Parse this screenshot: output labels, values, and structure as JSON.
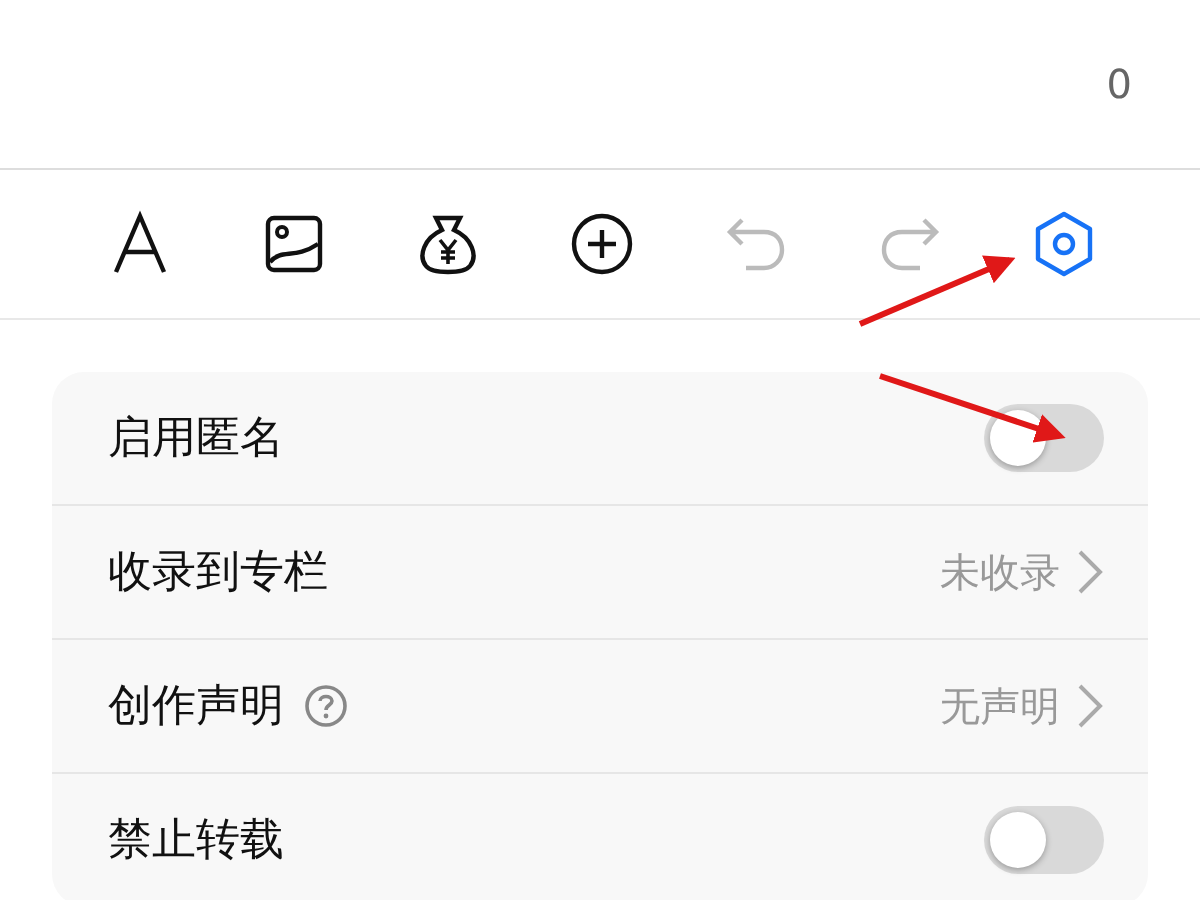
{
  "header": {
    "count": "0"
  },
  "toolbar": [
    {
      "kind": "text",
      "disabled": false,
      "active": false
    },
    {
      "kind": "image",
      "disabled": false,
      "active": false
    },
    {
      "kind": "money",
      "disabled": false,
      "active": false
    },
    {
      "kind": "add",
      "disabled": false,
      "active": false
    },
    {
      "kind": "undo",
      "disabled": true,
      "active": false
    },
    {
      "kind": "redo",
      "disabled": true,
      "active": false
    },
    {
      "kind": "settings",
      "disabled": false,
      "active": true
    }
  ],
  "settings": [
    {
      "kind": "toggle",
      "label": "启用匿名",
      "on": false
    },
    {
      "kind": "link",
      "label": "收录到专栏",
      "value": "未收录"
    },
    {
      "kind": "link",
      "label": "创作声明",
      "help": true,
      "value": "无声明"
    },
    {
      "kind": "toggle",
      "label": "禁止转载",
      "on": false
    }
  ]
}
